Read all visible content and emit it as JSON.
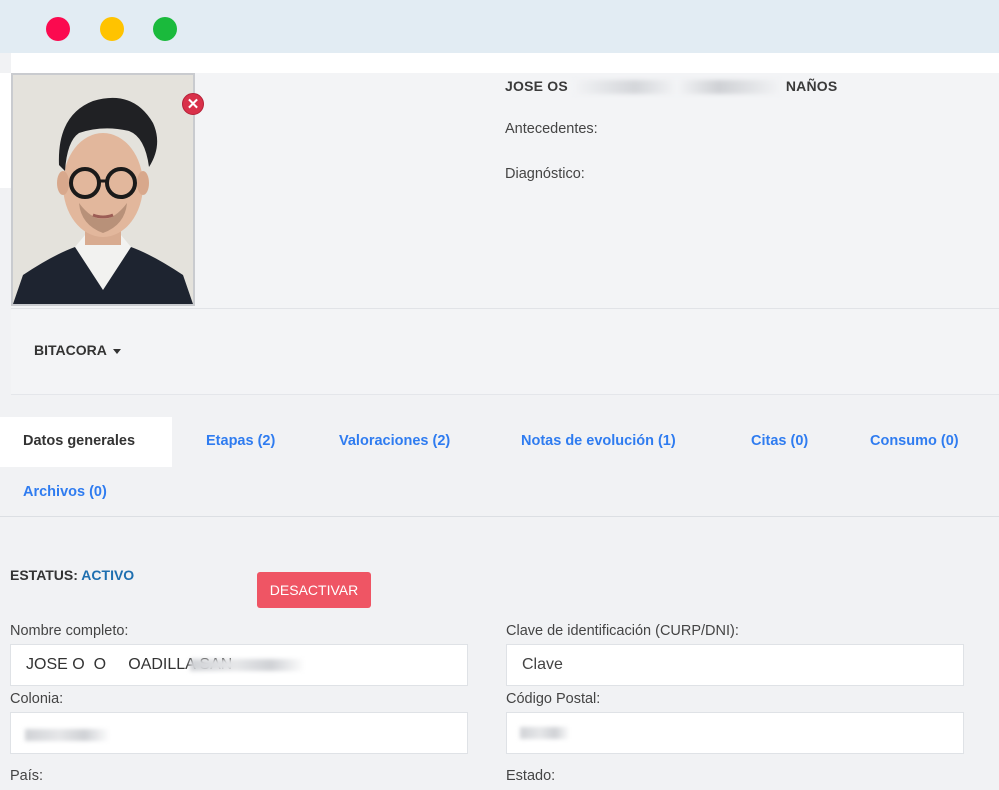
{
  "window": {
    "controls": [
      "close",
      "minimize",
      "maximize"
    ]
  },
  "patient": {
    "name_prefix": "JOSE OS",
    "name_middle": "CO",
    "name_fragment": "OS",
    "name_suffix": "NAÑOS",
    "antecedentes_label": "Antecedentes:",
    "diagnostico_label": "Diagnóstico:",
    "remove_photo_symbol": "✕"
  },
  "bitacora": {
    "label": "BITACORA"
  },
  "tabs": [
    {
      "label": "Datos generales",
      "active": true
    },
    {
      "label": "Etapas (2)"
    },
    {
      "label": "Valoraciones (2)"
    },
    {
      "label": "Notas de evolución (1)"
    },
    {
      "label": "Citas (0)"
    },
    {
      "label": "Consumo (0)"
    },
    {
      "label": "Archivos (0)"
    }
  ],
  "status": {
    "label": "ESTATUS:",
    "value": "ACTIVO",
    "action": "DESACTIVAR"
  },
  "form": {
    "nombre": {
      "label": "Nombre completo:",
      "value": "JOSE O  O     OADILLA SAN"
    },
    "clave": {
      "label": "Clave de identificación (CURP/DNI):",
      "placeholder": "Clave"
    },
    "colonia": {
      "label": "Colonia:",
      "value": ""
    },
    "cp": {
      "label": "Código Postal:",
      "value": ""
    },
    "pais": {
      "label": "País:"
    },
    "estado": {
      "label": "Estado:"
    }
  },
  "colors": {
    "accent": "#2f7cf0",
    "danger": "#ef5564",
    "status": "#1e6fb0"
  }
}
